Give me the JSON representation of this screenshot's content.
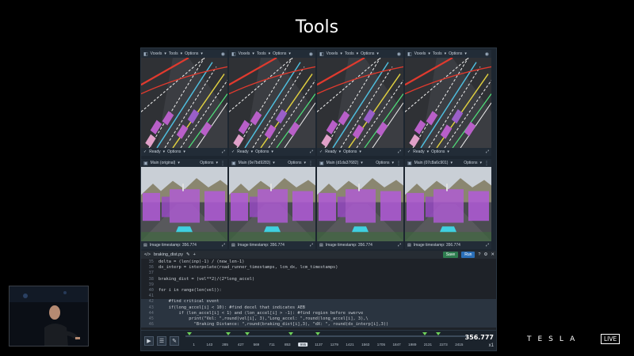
{
  "slide": {
    "title": "Tools"
  },
  "top_panels": [
    {
      "menu": [
        "Voxels",
        "Tools",
        "Options"
      ],
      "status": "Ready",
      "status_options": "Options"
    },
    {
      "menu": [
        "Voxels",
        "Tools",
        "Options"
      ],
      "status": "Ready",
      "status_options": "Options"
    },
    {
      "menu": [
        "Voxels",
        "Tools",
        "Options"
      ],
      "status": "Ready",
      "status_options": "Options"
    },
    {
      "menu": [
        "Voxels",
        "Tools",
        "Options"
      ],
      "status": "Ready",
      "status_options": "Options"
    }
  ],
  "bottom_panels": [
    {
      "camera": "Main (original)",
      "options": "Options",
      "timestamp": "Image timestamp: 356.774"
    },
    {
      "camera": "Main (0e7bd9283)",
      "options": "Options",
      "timestamp": "Image timestamp: 356.774"
    },
    {
      "camera": "Main (d1da37682)",
      "options": "Options",
      "timestamp": "Image timestamp: 356.774"
    },
    {
      "camera": "Main (07c8a6c901)",
      "options": "Options",
      "timestamp": "Image timestamp: 356.774"
    }
  ],
  "editor": {
    "filename": "braking_dist.py",
    "save": "Save",
    "run": "Run",
    "lines": [
      {
        "n": "35",
        "t": "delta = (len(inp)-1) / (new_len-1)"
      },
      {
        "n": "36",
        "t": "dx_interp = interpolate(road_runner_timestamps, lcm_dx, lcm_timestamps)"
      },
      {
        "n": "37",
        "t": ""
      },
      {
        "n": "38",
        "t": "braking_dist = (vel**2)/(2*long_accel)"
      },
      {
        "n": "39",
        "t": ""
      },
      {
        "n": "40",
        "t": "for i in range(len(vel)):"
      },
      {
        "n": "41",
        "t": ""
      },
      {
        "n": "42",
        "t": "    #find critical event"
      },
      {
        "n": "43",
        "t": "    if(long_accel[i] < 10): #find decel that indicates AEB"
      },
      {
        "n": "44",
        "t": "        if (lon_accel[i] < 1) and (lon_accel[i] > -1): #find region before swerve"
      },
      {
        "n": "45",
        "t": "            print(\"Vel: \",round(vel[i], 3),\"Long_accel: \",round(long_accel[i], 3),\\"
      },
      {
        "n": "46",
        "t": "              \"Braking Distance: \",round(braking_dist[i],3), \"dX: \", round(dx_interp[i],3))"
      }
    ]
  },
  "timeline": {
    "ticks": [
      "1",
      "143",
      "285",
      "427",
      "569",
      "711",
      "853",
      "995",
      "1137",
      "1279",
      "1421",
      "1563",
      "1705",
      "1847",
      "1989",
      "2131",
      "2273",
      "2415"
    ],
    "active_tick": 7,
    "time": "356.777",
    "speed": "x1"
  },
  "brand": {
    "wordmark": "TESLA",
    "live": "LIVE"
  }
}
